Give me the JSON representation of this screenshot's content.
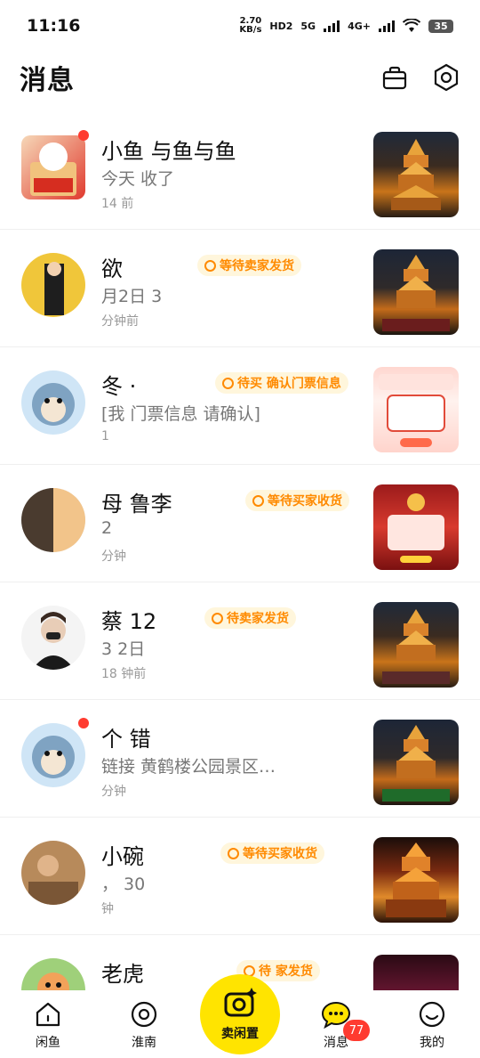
{
  "status_bar": {
    "time": "11:16",
    "speed_value": "2.70",
    "speed_unit": "KB/s",
    "hd_label": "HD2",
    "net1": "5G",
    "net2": "4G+",
    "battery": "35"
  },
  "header": {
    "title": "消息",
    "icons": [
      "bag-icon",
      "settings-hexagon-icon"
    ]
  },
  "conversations": [
    {
      "name": "小鱼 与鱼与鱼",
      "badge": "",
      "preview": "今天 收了 ",
      "time": "14 前",
      "badge_color": "#ff8a00"
    },
    {
      "name": "欲",
      "badge": "等待卖家发货",
      "preview": "月2日 3",
      "time": "分钟前",
      "badge_color": "#ff8a00"
    },
    {
      "name": "冬  ·",
      "badge": "待买 确认门票信息",
      "preview": "[我 门票信息 请确认]",
      "time": "1 ",
      "badge_color": "#ff8a00"
    },
    {
      "name": "母  鲁李",
      "badge": "等待买家收货",
      "preview": "2",
      "time": "分钟 ",
      "badge_color": "#ff8a00"
    },
    {
      "name": "蔡 12",
      "badge": "待卖家发货",
      "preview": "3 2日",
      "time": "18 钟前",
      "badge_color": "#ff8a00"
    },
    {
      "name": "个 错",
      "badge": "",
      "preview": "链接  黄鹤楼公园景区…",
      "time": "分钟",
      "badge_color": "#ff8a00"
    },
    {
      "name": "小碗",
      "badge": "等待买家收货",
      "preview": "， 30",
      "time": "钟",
      "badge_color": "#ff8a00"
    },
    {
      "name": "老虎",
      "badge": "待 家发货",
      "preview": "",
      "time": "",
      "badge_color": "#ff8a00"
    }
  ],
  "bottom_nav": {
    "items": [
      {
        "label": "闲鱼",
        "icon": "home-fish-icon"
      },
      {
        "label": "淮南",
        "icon": "location-pin-icon"
      },
      {
        "label": "卖闲置",
        "icon": "camera-sparkle-icon"
      },
      {
        "label": "消息",
        "icon": "chat-bubble-icon"
      },
      {
        "label": "我的",
        "icon": "smile-face-icon"
      }
    ],
    "message_count": "77"
  },
  "colors": {
    "accent": "#ffe400",
    "badge_text": "#ff8a00",
    "badge_bg": "#fff6dc",
    "alert": "#ff3b30"
  }
}
